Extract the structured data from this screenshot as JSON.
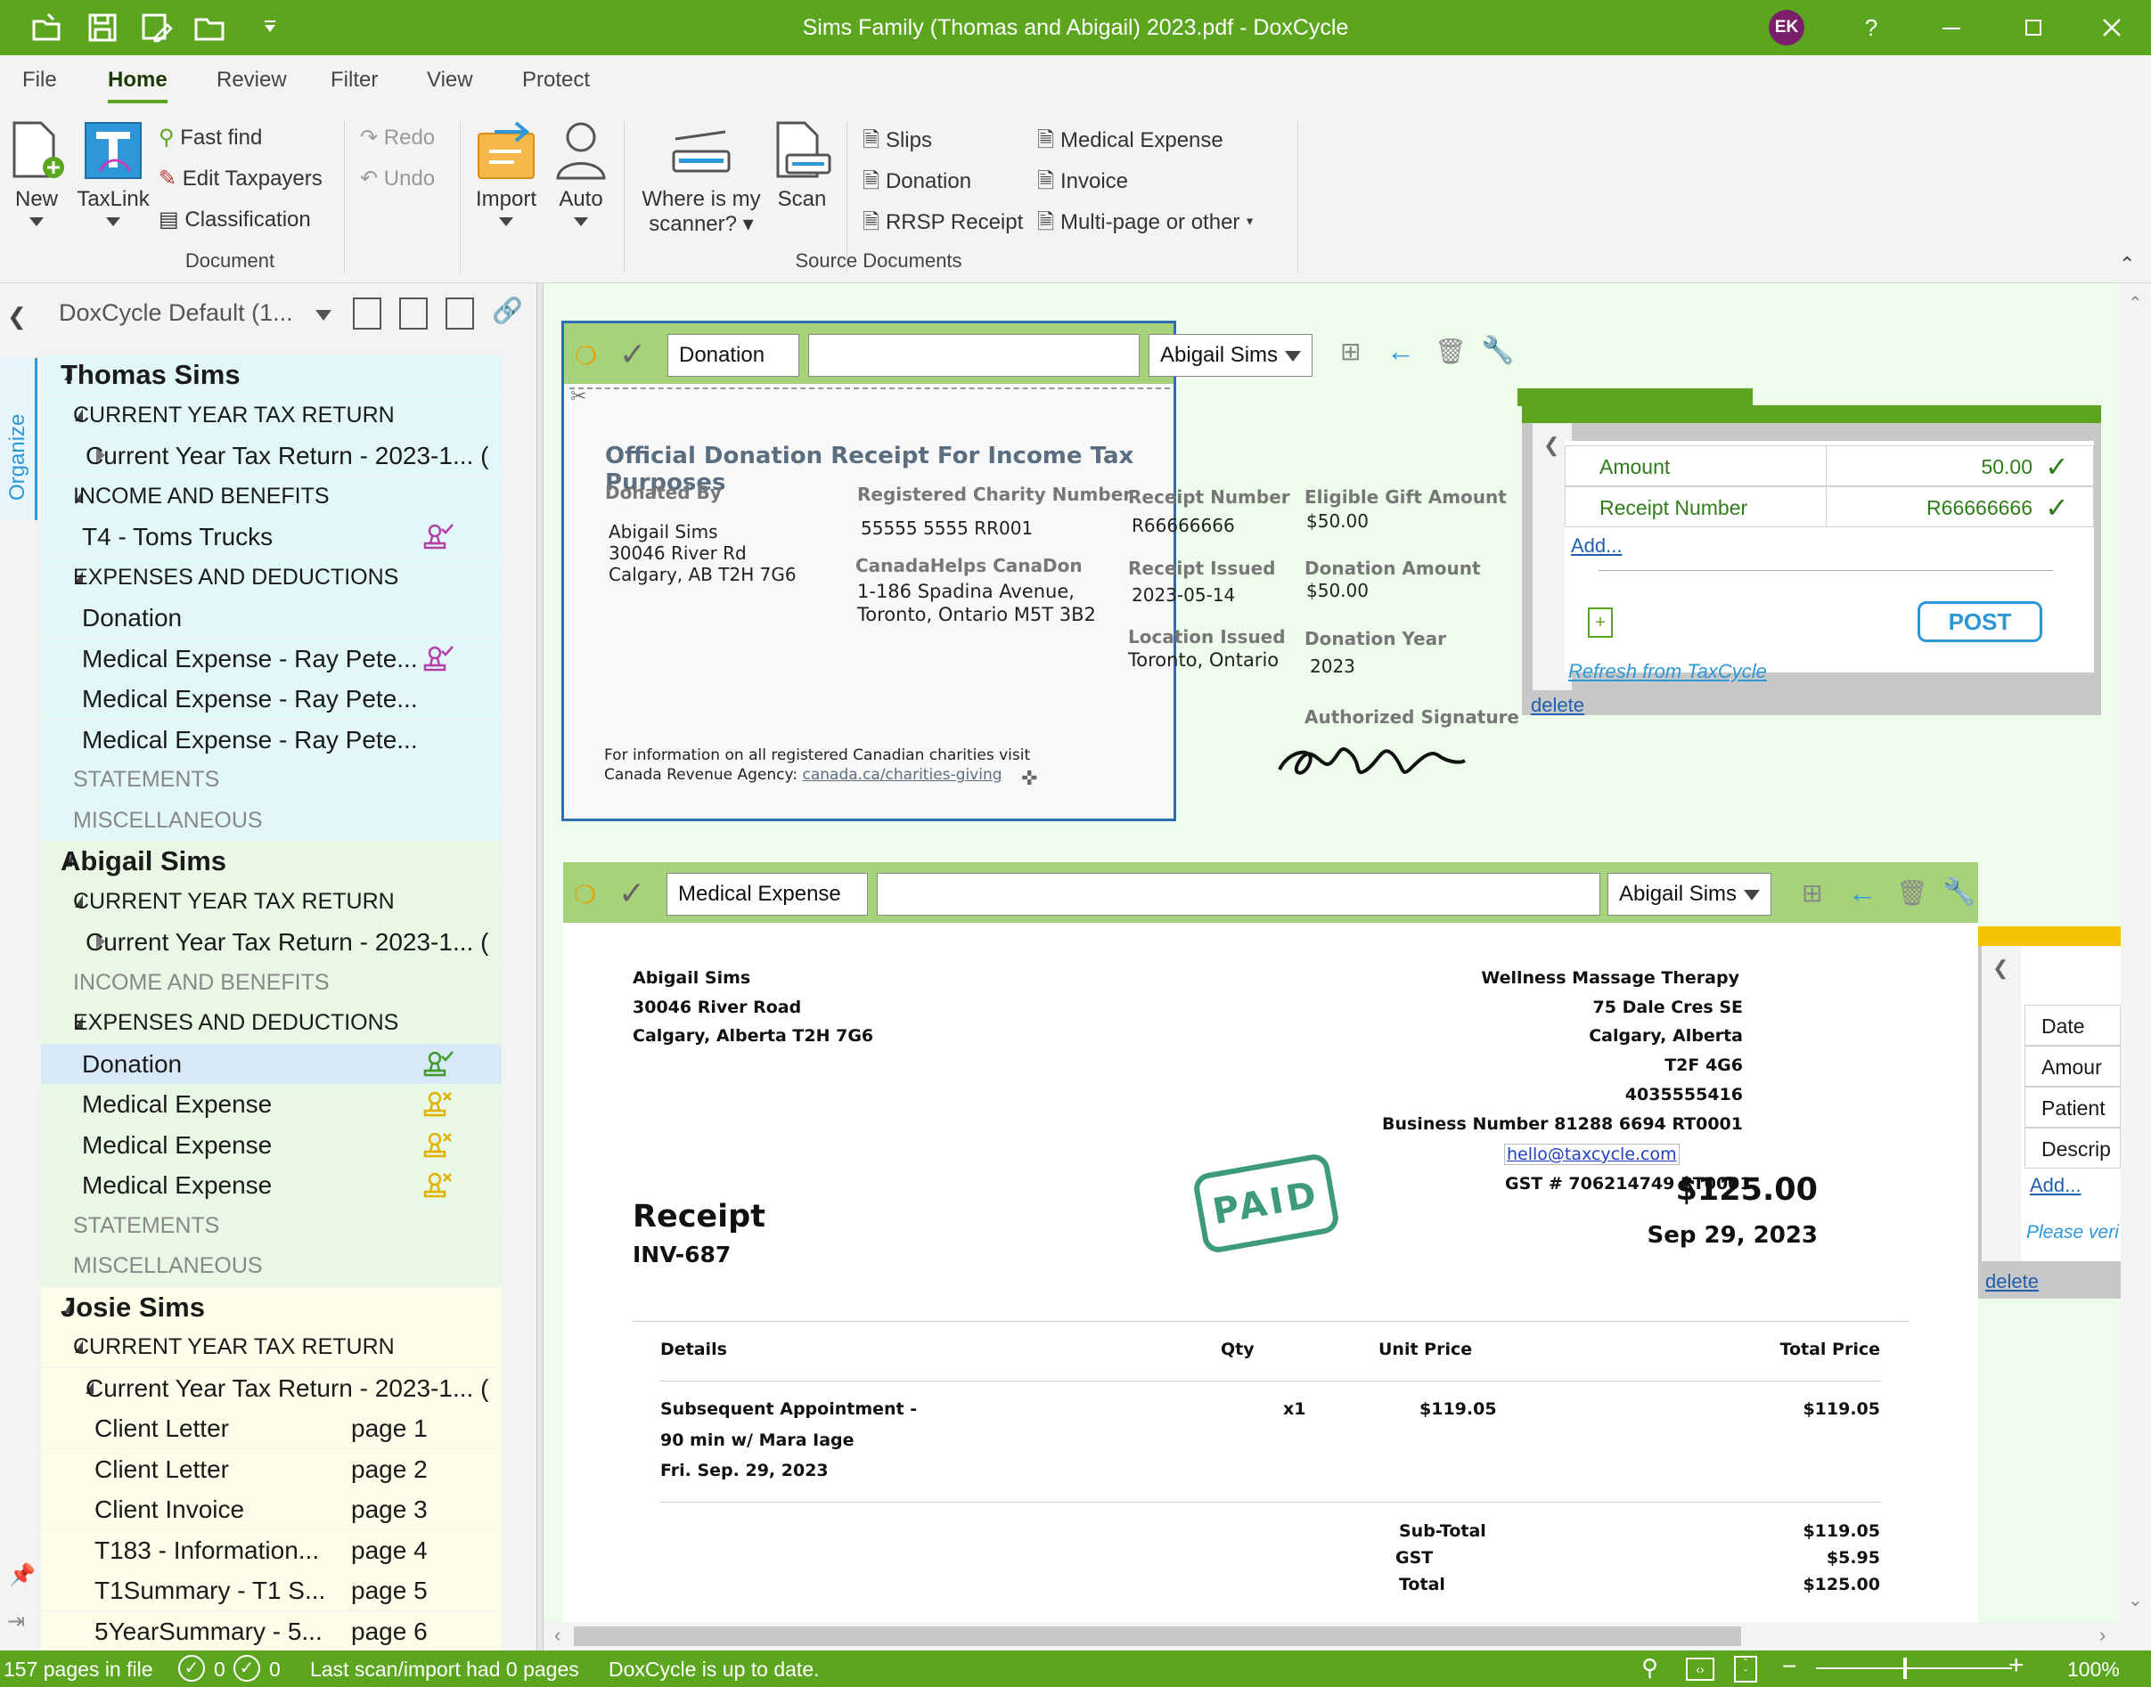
{
  "window": {
    "title": "Sims Family (Thomas and Abigail) 2023.pdf - DoxCycle",
    "user_initials": "EK",
    "help": "?",
    "accent": "#5ca51e"
  },
  "menu": [
    "File",
    "Home",
    "Review",
    "Filter",
    "View",
    "Protect"
  ],
  "ribbon": {
    "new": "New",
    "taxlink": "TaxLink",
    "fast_find": "Fast find",
    "edit_taxpayers": "Edit Taxpayers",
    "classification": "Classification",
    "redo": "Redo",
    "undo": "Undo",
    "group_document": "Document",
    "import": "Import",
    "auto": "Auto",
    "where_scanner_1": "Where is my",
    "where_scanner_2": "scanner?",
    "scan": "Scan",
    "slips": "Slips",
    "donation": "Donation",
    "rrsp": "RRSP Receipt",
    "medical": "Medical Expense",
    "invoice": "Invoice",
    "multipage": "Multi-page or other",
    "group_source": "Source Documents"
  },
  "side_tab": "Organize",
  "left_pane": {
    "profile": "DoxCycle Default (1...",
    "tree": [
      {
        "text": "Thomas Sims",
        "level": 0,
        "type": "person",
        "tw": "open"
      },
      {
        "text": "CURRENT YEAR TAX RETURN",
        "level": 1,
        "type": "cat",
        "tw": "open"
      },
      {
        "text": "Current Year Tax Return - 2023-1... (",
        "level": 2,
        "type": "item",
        "tw": "closed"
      },
      {
        "text": "INCOME AND BENEFITS",
        "level": 1,
        "type": "cat",
        "tw": "open"
      },
      {
        "text": "T4 - Toms Trucks",
        "level": 2,
        "type": "item",
        "stamp": "purple-check"
      },
      {
        "text": "EXPENSES AND DEDUCTIONS",
        "level": 1,
        "type": "cat",
        "tw": "open"
      },
      {
        "text": "Donation",
        "level": 2,
        "type": "item"
      },
      {
        "text": "Medical Expense - Ray Pete...",
        "level": 2,
        "type": "item",
        "stamp": "purple-check"
      },
      {
        "text": "Medical Expense - Ray Pete...",
        "level": 2,
        "type": "item"
      },
      {
        "text": "Medical Expense - Ray Pete...",
        "level": 2,
        "type": "item"
      },
      {
        "text": "STATEMENTS",
        "level": 1,
        "type": "cat-grey"
      },
      {
        "text": "MISCELLANEOUS",
        "level": 1,
        "type": "cat-grey"
      },
      {
        "text": "Abigail Sims",
        "level": 0,
        "type": "person",
        "tw": "open"
      },
      {
        "text": "CURRENT YEAR TAX RETURN",
        "level": 1,
        "type": "cat",
        "tw": "open"
      },
      {
        "text": "Current Year Tax Return - 2023-1... (",
        "level": 2,
        "type": "item",
        "tw": "closed"
      },
      {
        "text": "INCOME AND BENEFITS",
        "level": 1,
        "type": "cat-grey"
      },
      {
        "text": "EXPENSES AND DEDUCTIONS",
        "level": 1,
        "type": "cat",
        "tw": "open"
      },
      {
        "text": "Donation",
        "level": 2,
        "type": "item",
        "stamp": "green-check",
        "selected": true
      },
      {
        "text": "Medical Expense",
        "level": 2,
        "type": "item",
        "stamp": "yellow-x"
      },
      {
        "text": "Medical Expense",
        "level": 2,
        "type": "item",
        "stamp": "yellow-x"
      },
      {
        "text": "Medical Expense",
        "level": 2,
        "type": "item",
        "stamp": "yellow-x"
      },
      {
        "text": "STATEMENTS",
        "level": 1,
        "type": "cat-grey"
      },
      {
        "text": "MISCELLANEOUS",
        "level": 1,
        "type": "cat-grey"
      },
      {
        "text": "Josie Sims",
        "level": 0,
        "type": "person",
        "tw": "open"
      },
      {
        "text": "CURRENT YEAR TAX RETURN",
        "level": 1,
        "type": "cat",
        "tw": "open"
      },
      {
        "text": "Current Year Tax Return - 2023-1... (",
        "level": 2,
        "type": "item",
        "tw": "open"
      },
      {
        "text": "Client Letter",
        "level": 3,
        "type": "page",
        "page": "page 1"
      },
      {
        "text": "Client Letter",
        "level": 3,
        "type": "page",
        "page": "page 2"
      },
      {
        "text": "Client Invoice",
        "level": 3,
        "type": "page",
        "page": "page 3"
      },
      {
        "text": "T183 - Information...",
        "level": 3,
        "type": "page",
        "page": "page 4"
      },
      {
        "text": "T1Summary - T1 S...",
        "level": 3,
        "type": "page",
        "page": "page 5"
      },
      {
        "text": "5YearSummary - 5...",
        "level": 3,
        "type": "page",
        "page": "page 6"
      }
    ]
  },
  "doc1": {
    "type": "Donation",
    "taxpayer": "Abigail Sims",
    "receipt": {
      "title": "Official Donation Receipt For Income Tax Purposes",
      "donated_by_label": "Donated By",
      "donor_name": "Abigail Sims",
      "donor_addr1": "30046 River Rd",
      "donor_addr2": "Calgary, AB T2H 7G6",
      "charity_num_label": "Registered Charity Number",
      "charity_num": "55555 5555 RR001",
      "charity_name": "CanadaHelps CanaDon",
      "charity_addr1": "1-186 Spadina Avenue,",
      "charity_addr2": "Toronto, Ontario M5T 3B2",
      "receipt_num_label": "Receipt Number",
      "receipt_num": "R66666666",
      "issued_label": "Receipt Issued",
      "issued": "2023-05-14",
      "location_label": "Location Issued",
      "location": "Toronto, Ontario",
      "eligible_label": "Eligible Gift Amount",
      "eligible": "$50.00",
      "don_amount_label": "Donation Amount",
      "don_amount": "$50.00",
      "don_year_label": "Donation Year",
      "don_year": "2023",
      "auth_sig": "Authorized Signature",
      "footer1": "For information on all registered Canadian charities visit",
      "footer2": "Canada Revenue Agency:",
      "footer_link": "canada.ca/charities-giving"
    },
    "fields": [
      {
        "label": "Amount",
        "value": "50.00"
      },
      {
        "label": "Receipt Number",
        "value": "R66666666"
      }
    ],
    "add": "Add...",
    "post": "POST",
    "refresh": "Refresh from TaxCycle",
    "delete": "delete"
  },
  "doc2": {
    "type": "Medical Expense",
    "taxpayer": "Abigail Sims",
    "fields": [
      "Date",
      "Amour",
      "Patient",
      "Descrip"
    ],
    "add": "Add...",
    "please": "Please veri",
    "delete": "delete",
    "invoice": {
      "bill_name": "Abigail Sims",
      "bill_addr1": "30046 River Road",
      "bill_addr2": "Calgary, Alberta T2H 7G6",
      "biz_name": "Wellness Massage Therapy",
      "biz_addr1": "75 Dale Cres SE",
      "biz_addr2": "Calgary, Alberta",
      "biz_postal": "T2F 4G6",
      "biz_phone": "4035555416",
      "biz_number": "Business Number 81288 6694 RT0001",
      "biz_email": "hello@taxcycle.com",
      "gst": "GST # 706214749 RT0001",
      "paid": "PAID",
      "receipt_title": "Receipt",
      "inv_no": "INV-687",
      "total_big": "$125.00",
      "date_big": "Sep 29, 2023",
      "columns": [
        "Details",
        "Qty",
        "Unit Price",
        "Total Price"
      ],
      "line1": "Subsequent Appointment -",
      "line2": "90 min w/ Mara Iage",
      "line3": "Fri. Sep. 29, 2023",
      "qty": "x1",
      "unit": "$119.05",
      "total": "$119.05",
      "subtotal_label": "Sub-Total",
      "subtotal": "$119.05",
      "gst_label": "GST",
      "gst_val": "$5.95",
      "total_label": "Total",
      "total_val": "$125.00"
    }
  },
  "status": {
    "pages": "157 pages in file",
    "count1": "0",
    "count2": "0",
    "last_scan": "Last scan/import had 0 pages",
    "uptodate": "DoxCycle is up to date.",
    "zoom": "100%"
  }
}
